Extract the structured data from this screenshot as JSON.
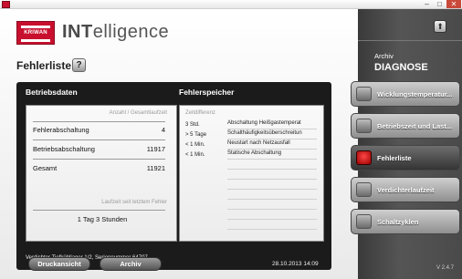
{
  "logo_text": "KRIWAN",
  "brand": {
    "prefix": "INT",
    "rest": "elligence"
  },
  "page_title": "Fehlerliste",
  "help_label": "?",
  "left_panel": {
    "header": "Betriebsdaten",
    "col_hint": "Anzahl / Gesamtlaufzeit",
    "rows": [
      {
        "label": "Fehlerabschaltung",
        "value": "4"
      },
      {
        "label": "Betriebsabschaltung",
        "value": "11917"
      },
      {
        "label": "Gesamt",
        "value": "11921"
      }
    ],
    "runtime_hint": "Laufzeit seit letztem Fehler",
    "runtime_value": "1 Tag 3 Stunden"
  },
  "right_panel": {
    "header": "Fehlerspeicher",
    "col_hint": "Zeitdifferenz",
    "entries": [
      {
        "time": "3 Std.",
        "text": "Abschaltung Heißgastemperat"
      },
      {
        "time": "> 5 Tage",
        "text": "Schalthäufigkeitsüberschreitun"
      },
      {
        "time": "< 1 Min.",
        "text": "Neustart nach Netzausfall"
      },
      {
        "time": "< 1 Min.",
        "text": "Statische Abschaltung"
      }
    ]
  },
  "device_info": "Verdichter Tiefkühllager 1/2, Seriennummer 64707",
  "buttons": {
    "print": "Druckansicht",
    "archive": "Archiv"
  },
  "datetime": "28.10.2013 14:09",
  "sidebar": {
    "archive_label": "Archiv",
    "diagnose_label": "DIAGNOSE",
    "items": [
      {
        "label": "Wicklungstemperatur..."
      },
      {
        "label": "Betriebszeit und Last..."
      },
      {
        "label": "Fehlerliste"
      },
      {
        "label": "Verdichterlaufzeit"
      },
      {
        "label": "Schaltzyklen"
      }
    ],
    "active_index": 2,
    "version": "V 2.4.7"
  },
  "colors": {
    "brand_red": "#c8102e",
    "active_indicator": "#e02020",
    "panel_bg": "#1b1b1b"
  }
}
